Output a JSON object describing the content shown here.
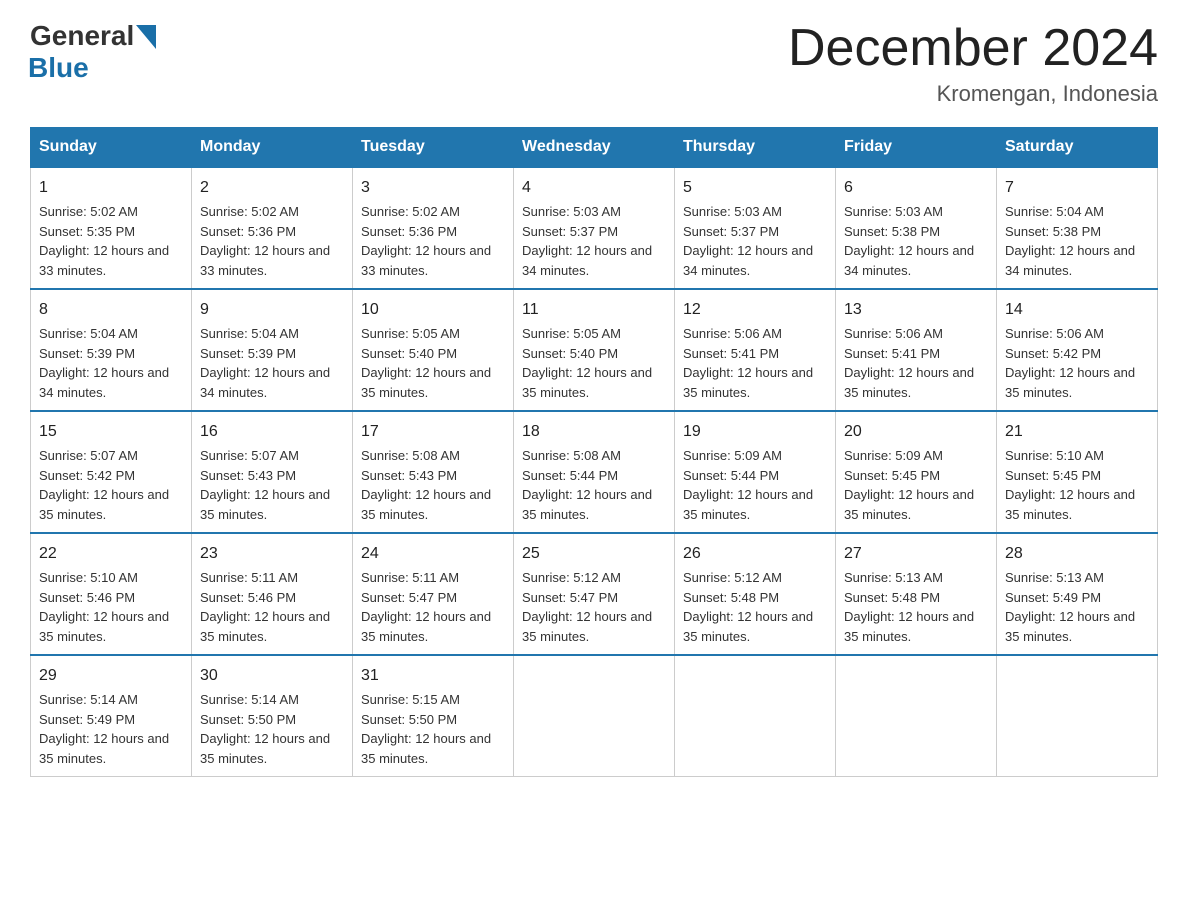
{
  "logo": {
    "general": "General",
    "blue": "Blue",
    "triangle_color": "#1a6fa8"
  },
  "title": "December 2024",
  "subtitle": "Kromengan, Indonesia",
  "headers": [
    "Sunday",
    "Monday",
    "Tuesday",
    "Wednesday",
    "Thursday",
    "Friday",
    "Saturday"
  ],
  "weeks": [
    [
      {
        "day": "1",
        "sunrise": "5:02 AM",
        "sunset": "5:35 PM",
        "daylight": "12 hours and 33 minutes."
      },
      {
        "day": "2",
        "sunrise": "5:02 AM",
        "sunset": "5:36 PM",
        "daylight": "12 hours and 33 minutes."
      },
      {
        "day": "3",
        "sunrise": "5:02 AM",
        "sunset": "5:36 PM",
        "daylight": "12 hours and 33 minutes."
      },
      {
        "day": "4",
        "sunrise": "5:03 AM",
        "sunset": "5:37 PM",
        "daylight": "12 hours and 34 minutes."
      },
      {
        "day": "5",
        "sunrise": "5:03 AM",
        "sunset": "5:37 PM",
        "daylight": "12 hours and 34 minutes."
      },
      {
        "day": "6",
        "sunrise": "5:03 AM",
        "sunset": "5:38 PM",
        "daylight": "12 hours and 34 minutes."
      },
      {
        "day": "7",
        "sunrise": "5:04 AM",
        "sunset": "5:38 PM",
        "daylight": "12 hours and 34 minutes."
      }
    ],
    [
      {
        "day": "8",
        "sunrise": "5:04 AM",
        "sunset": "5:39 PM",
        "daylight": "12 hours and 34 minutes."
      },
      {
        "day": "9",
        "sunrise": "5:04 AM",
        "sunset": "5:39 PM",
        "daylight": "12 hours and 34 minutes."
      },
      {
        "day": "10",
        "sunrise": "5:05 AM",
        "sunset": "5:40 PM",
        "daylight": "12 hours and 35 minutes."
      },
      {
        "day": "11",
        "sunrise": "5:05 AM",
        "sunset": "5:40 PM",
        "daylight": "12 hours and 35 minutes."
      },
      {
        "day": "12",
        "sunrise": "5:06 AM",
        "sunset": "5:41 PM",
        "daylight": "12 hours and 35 minutes."
      },
      {
        "day": "13",
        "sunrise": "5:06 AM",
        "sunset": "5:41 PM",
        "daylight": "12 hours and 35 minutes."
      },
      {
        "day": "14",
        "sunrise": "5:06 AM",
        "sunset": "5:42 PM",
        "daylight": "12 hours and 35 minutes."
      }
    ],
    [
      {
        "day": "15",
        "sunrise": "5:07 AM",
        "sunset": "5:42 PM",
        "daylight": "12 hours and 35 minutes."
      },
      {
        "day": "16",
        "sunrise": "5:07 AM",
        "sunset": "5:43 PM",
        "daylight": "12 hours and 35 minutes."
      },
      {
        "day": "17",
        "sunrise": "5:08 AM",
        "sunset": "5:43 PM",
        "daylight": "12 hours and 35 minutes."
      },
      {
        "day": "18",
        "sunrise": "5:08 AM",
        "sunset": "5:44 PM",
        "daylight": "12 hours and 35 minutes."
      },
      {
        "day": "19",
        "sunrise": "5:09 AM",
        "sunset": "5:44 PM",
        "daylight": "12 hours and 35 minutes."
      },
      {
        "day": "20",
        "sunrise": "5:09 AM",
        "sunset": "5:45 PM",
        "daylight": "12 hours and 35 minutes."
      },
      {
        "day": "21",
        "sunrise": "5:10 AM",
        "sunset": "5:45 PM",
        "daylight": "12 hours and 35 minutes."
      }
    ],
    [
      {
        "day": "22",
        "sunrise": "5:10 AM",
        "sunset": "5:46 PM",
        "daylight": "12 hours and 35 minutes."
      },
      {
        "day": "23",
        "sunrise": "5:11 AM",
        "sunset": "5:46 PM",
        "daylight": "12 hours and 35 minutes."
      },
      {
        "day": "24",
        "sunrise": "5:11 AM",
        "sunset": "5:47 PM",
        "daylight": "12 hours and 35 minutes."
      },
      {
        "day": "25",
        "sunrise": "5:12 AM",
        "sunset": "5:47 PM",
        "daylight": "12 hours and 35 minutes."
      },
      {
        "day": "26",
        "sunrise": "5:12 AM",
        "sunset": "5:48 PM",
        "daylight": "12 hours and 35 minutes."
      },
      {
        "day": "27",
        "sunrise": "5:13 AM",
        "sunset": "5:48 PM",
        "daylight": "12 hours and 35 minutes."
      },
      {
        "day": "28",
        "sunrise": "5:13 AM",
        "sunset": "5:49 PM",
        "daylight": "12 hours and 35 minutes."
      }
    ],
    [
      {
        "day": "29",
        "sunrise": "5:14 AM",
        "sunset": "5:49 PM",
        "daylight": "12 hours and 35 minutes."
      },
      {
        "day": "30",
        "sunrise": "5:14 AM",
        "sunset": "5:50 PM",
        "daylight": "12 hours and 35 minutes."
      },
      {
        "day": "31",
        "sunrise": "5:15 AM",
        "sunset": "5:50 PM",
        "daylight": "12 hours and 35 minutes."
      },
      null,
      null,
      null,
      null
    ]
  ],
  "labels": {
    "sunrise": "Sunrise: ",
    "sunset": "Sunset: ",
    "daylight": "Daylight: "
  }
}
